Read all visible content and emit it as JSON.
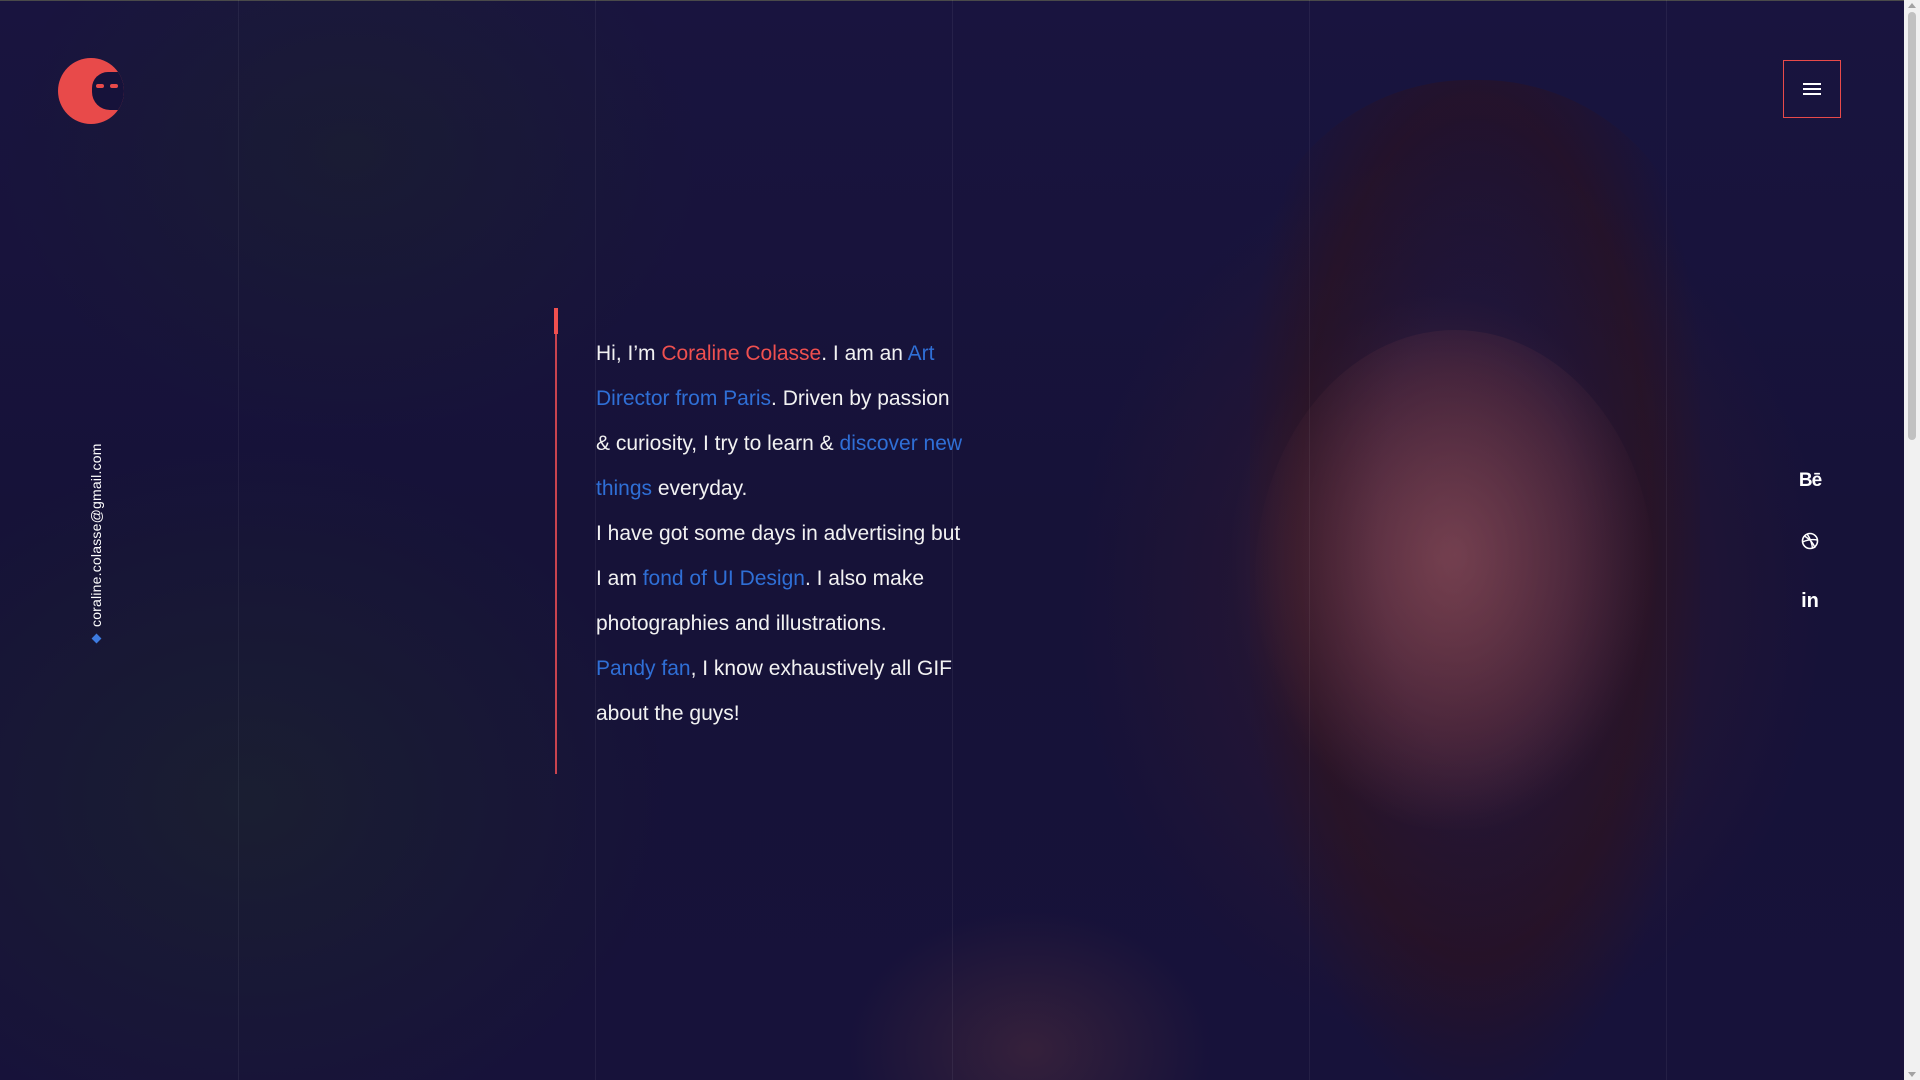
{
  "header": {
    "logo_icon": "red-round-face-logo-icon",
    "menu_icon": "hamburger-menu-icon"
  },
  "sidebar": {
    "email": "coraline.colasse@gmail.com",
    "bullet_icon": "diamond-icon"
  },
  "intro": {
    "p1_hi": "Hi, I’m ",
    "p1_name": "Coraline Colasse",
    "p1_am": ". I am an ",
    "p1_role": "Art Director from Paris",
    "p1_driven": ". Driven by passion & curiosity, I try to learn & ",
    "p1_discover": "discover new things",
    "p1_everyday": " everyday.",
    "p2_start": "I have got some days in advertising but I am ",
    "p2_link": "fond of UI Design",
    "p2_end": ". I also make photographies and illustrations.",
    "p3_link": "Pandy fan",
    "p3_end": ", I know exhaustively all GIF about the guys!"
  },
  "social": {
    "behance": "Bē",
    "dribbble_icon": "dribbble-icon",
    "linkedin": "in"
  },
  "colors": {
    "background": "#16123a",
    "accent_red": "#f0504f",
    "accent_blue": "#2f6fd6",
    "text": "#f2f2f2"
  }
}
